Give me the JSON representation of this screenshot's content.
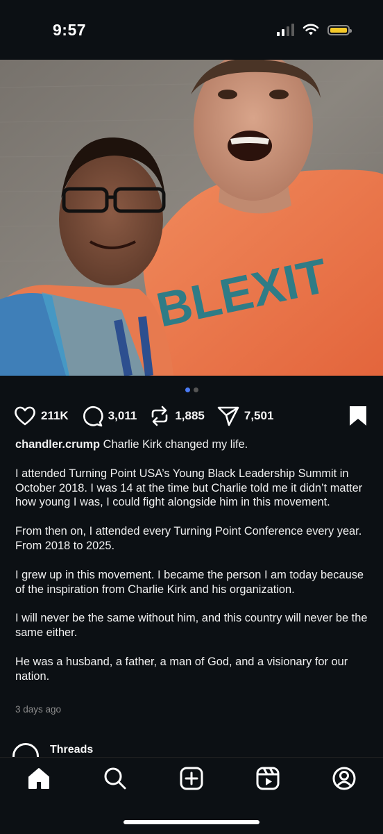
{
  "status_bar": {
    "time": "9:57"
  },
  "post": {
    "carousel": {
      "count": 2,
      "active_index": 0
    },
    "actions": {
      "likes": "211K",
      "comments": "3,011",
      "reposts": "1,885",
      "shares": "7,501"
    },
    "caption": {
      "username": "chandler.crump",
      "first_line": "Charlie Kirk changed my life.",
      "paragraphs": [
        "I attended Turning Point USA’s Young Black Leadership Summit in October 2018. I was 14 at the time but Charlie told me it didn’t matter how young I was, I could fight alongside him in this movement.",
        "From then on, I attended every Turning Point Conference every year. From 2018 to 2025.",
        "I grew up in this movement. I became the person I am today because of the inspiration from Charlie Kirk and his organization.",
        "I will never be the same without him, and this country will never be the same either.",
        "He was a husband, a father, a man of God, and a visionary for our nation."
      ]
    },
    "timestamp": "3 days ago",
    "shirt_text": "BLEXIT"
  },
  "threads_row": {
    "label": "Threads"
  },
  "tab_bar": {
    "items": [
      "home-icon",
      "search-icon",
      "create-icon",
      "reels-icon",
      "profile-icon"
    ],
    "active": "home-icon"
  },
  "colors": {
    "background": "#0c1014",
    "accent": "#4b7bf5",
    "battery": "#f5c928",
    "shirt": "#e8764e"
  }
}
